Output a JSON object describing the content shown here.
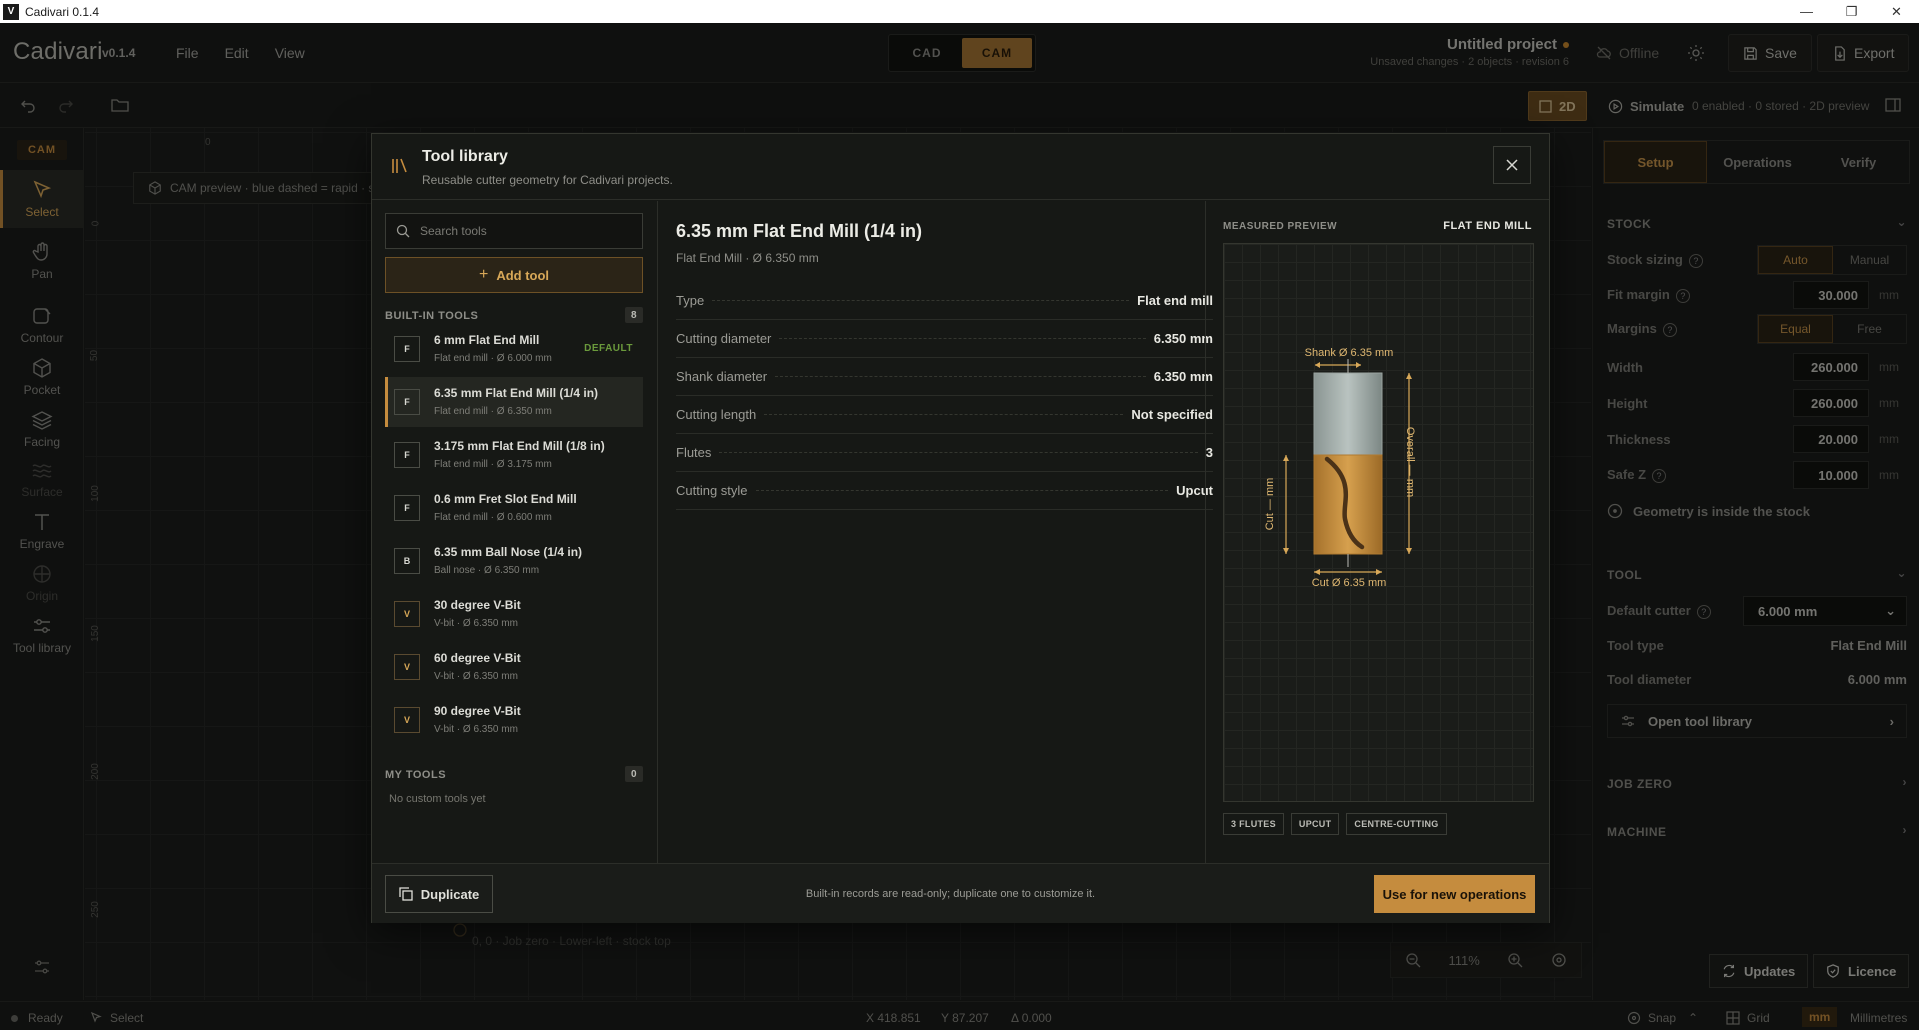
{
  "window": {
    "title": "Cadivari 0.1.4",
    "logo": "V"
  },
  "header": {
    "brand": "Cadivari",
    "version": "v0.1.4",
    "menu": [
      "File",
      "Edit",
      "View"
    ],
    "modes": [
      "CAD",
      "CAM"
    ],
    "active_mode": "CAM",
    "project_title": "Untitled project",
    "project_sub": "Unsaved changes · 2 objects · revision 6",
    "offline": "Offline",
    "save": "Save",
    "export": "Export"
  },
  "toolbar": {
    "view_2d": "2D",
    "simulate": "Simulate",
    "status": "0 enabled · 0 stored · 2D preview"
  },
  "sidebar": {
    "section": "CAM",
    "items": [
      {
        "label": "Select",
        "icon": "cursor-icon"
      },
      {
        "label": "Pan",
        "icon": "hand-icon"
      },
      {
        "label": "Contour",
        "icon": "contour-icon"
      },
      {
        "label": "Pocket",
        "icon": "cube-icon"
      },
      {
        "label": "Facing",
        "icon": "layers-icon"
      },
      {
        "label": "Surface",
        "icon": "waves-icon"
      },
      {
        "label": "Engrave",
        "icon": "text-icon"
      },
      {
        "label": "Origin",
        "icon": "crosshair-icon"
      },
      {
        "label": "Tool library",
        "icon": "sliders-icon"
      }
    ]
  },
  "canvas": {
    "note": "CAM preview · blue dashed = rapid · solid = cut",
    "ruler_x": [
      "0",
      "50",
      "100",
      "150",
      "200",
      "250"
    ],
    "ruler_y": [
      "0",
      "50",
      "100",
      "150",
      "200",
      "250"
    ],
    "origin_label": "0, 0 · Job zero · Lower-left · stock top",
    "zoom": "111%"
  },
  "right_panel": {
    "tabs": [
      "Setup",
      "Operations",
      "Verify"
    ],
    "stock": {
      "title": "STOCK",
      "sizing_label": "Stock sizing",
      "sizing_opts": [
        "Auto",
        "Manual"
      ],
      "fit_label": "Fit margin",
      "fit": "30.000",
      "margins_label": "Margins",
      "margins_opts": [
        "Equal",
        "Free"
      ],
      "width_label": "Width",
      "width": "260.000",
      "height_label": "Height",
      "height": "260.000",
      "thickness_label": "Thickness",
      "thickness": "20.000",
      "safez_label": "Safe Z",
      "safez": "10.000",
      "unit": "mm",
      "inside": "Geometry is inside the stock"
    },
    "tool": {
      "title": "TOOL",
      "cutter_label": "Default cutter",
      "cutter": "6.000 mm",
      "type_label": "Tool type",
      "type": "Flat End Mill",
      "dia_label": "Tool diameter",
      "dia": "6.000 mm",
      "open": "Open tool library"
    },
    "job_zero": "JOB ZERO",
    "machine": "MACHINE",
    "updates": "Updates",
    "licence": "Licence"
  },
  "status": {
    "ready": "Ready",
    "mode": "Select",
    "x": "X 418.851",
    "y": "Y 87.207",
    "delta": "Δ 0.000",
    "snap": "Snap",
    "grid": "Grid",
    "unit": "mm",
    "units_full": "Millimetres"
  },
  "modal": {
    "title": "Tool library",
    "subtitle": "Reusable cutter geometry for Cadivari projects.",
    "search_placeholder": "Search tools",
    "add_tool": "Add tool",
    "builtin_title": "BUILT-IN TOOLS",
    "builtin_count": "8",
    "default_label": "DEFAULT",
    "tools": [
      {
        "badge": "F",
        "name": "6 mm Flat End Mill",
        "meta": "Flat end mill · Ø 6.000 mm"
      },
      {
        "badge": "F",
        "name": "6.35 mm Flat End Mill (1/4 in)",
        "meta": "Flat end mill · Ø 6.350 mm"
      },
      {
        "badge": "F",
        "name": "3.175 mm Flat End Mill (1/8 in)",
        "meta": "Flat end mill · Ø 3.175 mm"
      },
      {
        "badge": "F",
        "name": "0.6 mm Fret Slot End Mill",
        "meta": "Flat end mill · Ø 0.600 mm"
      },
      {
        "badge": "B",
        "name": "6.35 mm Ball Nose (1/4 in)",
        "meta": "Ball nose · Ø 6.350 mm"
      },
      {
        "badge": "V",
        "name": "30 degree V-Bit",
        "meta": "V-bit · Ø 6.350 mm"
      },
      {
        "badge": "V",
        "name": "60 degree V-Bit",
        "meta": "V-bit · Ø 6.350 mm"
      },
      {
        "badge": "V",
        "name": "90 degree V-Bit",
        "meta": "V-bit · Ø 6.350 mm"
      }
    ],
    "my_tools_title": "MY TOOLS",
    "my_tools_count": "0",
    "no_custom": "No custom tools yet",
    "detail": {
      "title": "6.35 mm Flat End Mill (1/4 in)",
      "subtitle": "Flat End Mill · Ø 6.350 mm",
      "rows": [
        {
          "label": "Type",
          "value": "Flat end mill"
        },
        {
          "label": "Cutting diameter",
          "value": "6.350 mm"
        },
        {
          "label": "Shank diameter",
          "value": "6.350 mm"
        },
        {
          "label": "Cutting length",
          "value": "Not specified"
        },
        {
          "label": "Flutes",
          "value": "3"
        },
        {
          "label": "Cutting style",
          "value": "Upcut"
        }
      ]
    },
    "preview": {
      "heading": "MEASURED PREVIEW",
      "type": "FLAT END MILL",
      "shank": "Shank Ø 6.35 mm",
      "cut": "Cut Ø 6.35 mm",
      "overall": "Overall — mm",
      "cutlen": "Cut — mm",
      "tags": [
        "3 FLUTES",
        "UPCUT",
        "CENTRE-CUTTING"
      ]
    },
    "duplicate": "Duplicate",
    "note": "Built-in records are read-only; duplicate one to customize it.",
    "use": "Use for new operations"
  },
  "colors": {
    "accent": "#c58c3e",
    "bg": "#1b1c1a",
    "default_green": "#6b9a3c"
  }
}
